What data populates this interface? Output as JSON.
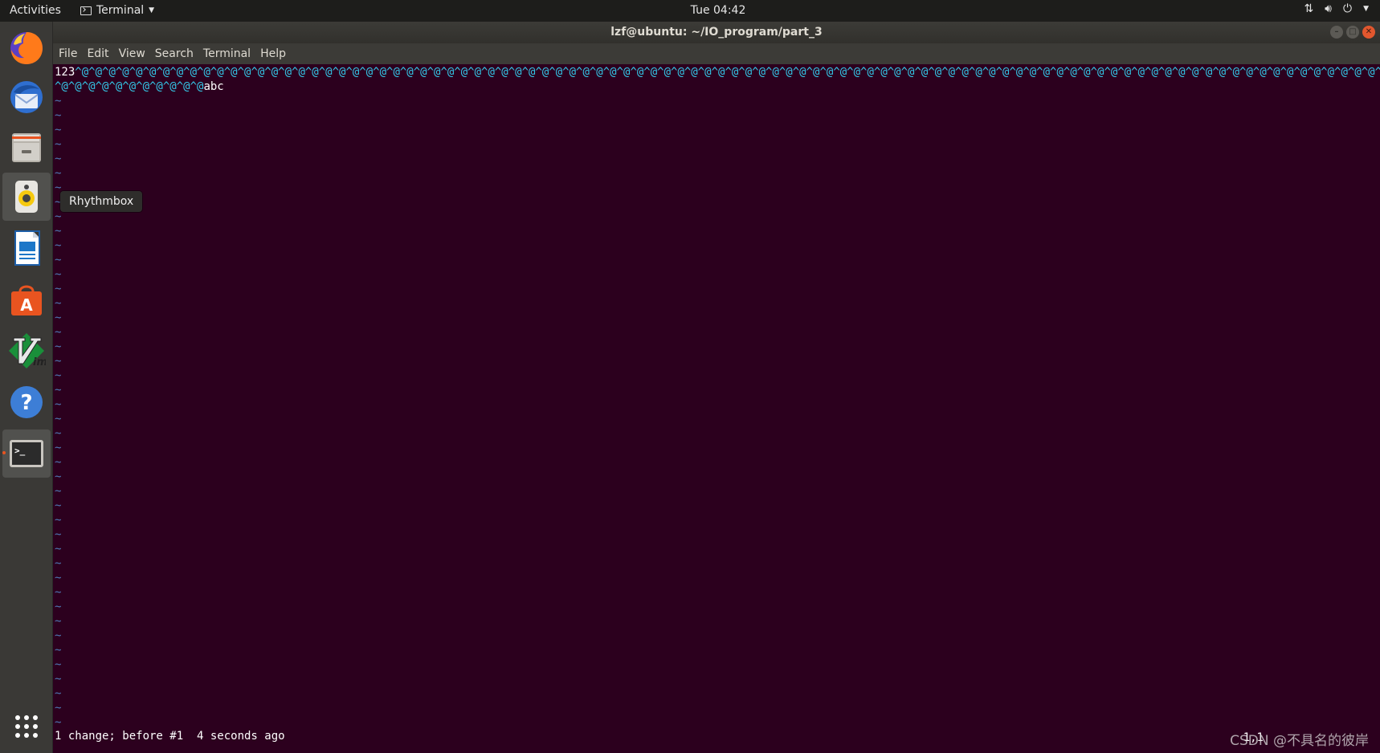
{
  "topbar": {
    "activities": "Activities",
    "app_menu": "Terminal",
    "clock": "Tue 04:42"
  },
  "window": {
    "title": "lzf@ubuntu: ~/IO_program/part_3",
    "menu": [
      "File",
      "Edit",
      "View",
      "Search",
      "Terminal",
      "Help"
    ]
  },
  "dock": {
    "items": [
      "firefox-icon",
      "thunderbird-icon",
      "files-icon",
      "rhythmbox-icon",
      "writer-icon",
      "software-center-icon",
      "vim-icon",
      "help-icon",
      "terminal-icon",
      "show-apps-icon"
    ],
    "tooltip": "Rhythmbox"
  },
  "editor": {
    "line1_start": "123",
    "line1_ctrl": "^@^@^@^@^@^@^@^@^@^@^@^@^@^@^@^@^@^@^@^@^@^@^@^@^@^@^@^@^@^@^@^@^@^@^@^@^@^@^@^@^@^@^@^@^@^@^@^@^@^@^@^@^@^@^@^@^@^@^@^@^@^@^@^@^@^@^@^@^@^@^@^@^@^@^@^@^@^@^@^@^@^@^@^@^@^@^@^@^@^@^@^@^@^@^@^@^@",
    "line2_ctrl": "^@^@^@^@^@^@^@^@^@^@^@",
    "line2_end": "abc",
    "tilde": "~",
    "status": "1 change; before #1  4 seconds ago",
    "cursor_pos": "1,1"
  },
  "watermark": "CSDN @不具名的彼岸"
}
